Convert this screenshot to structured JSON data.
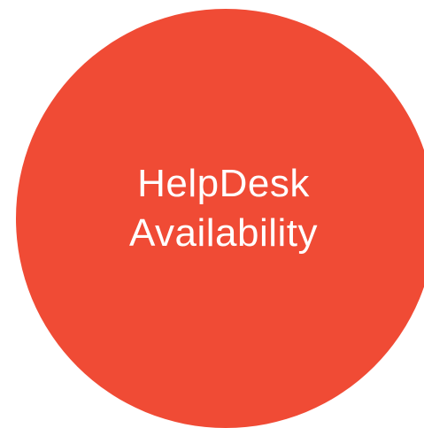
{
  "badge": {
    "line1": "HelpDesk",
    "line2": "Availability",
    "fill_color": "#f04b35",
    "text_color": "#ffffff"
  }
}
